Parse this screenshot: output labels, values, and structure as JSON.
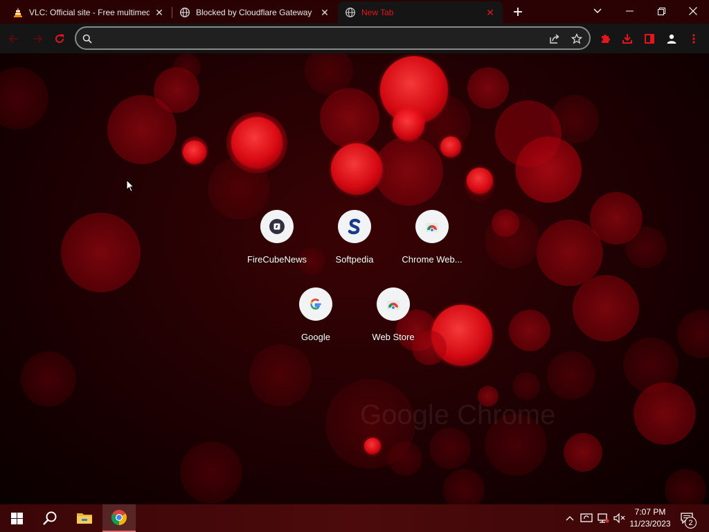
{
  "browser": {
    "tabs": [
      {
        "title": "VLC: Official site - Free multimedia",
        "icon": "vlc-cone-icon",
        "active": false
      },
      {
        "title": "Blocked by Cloudflare Gateway",
        "icon": "globe-icon",
        "active": false
      },
      {
        "title": "New Tab",
        "icon": "globe-icon",
        "active": true
      }
    ],
    "omnibox": {
      "value": "",
      "placeholder": ""
    },
    "accent_color": "#e8141b"
  },
  "shortcuts": [
    {
      "label": "FireCubeNews",
      "icon": "firecubenews-icon"
    },
    {
      "label": "Softpedia",
      "icon": "softpedia-s-icon"
    },
    {
      "label": "Chrome Web...",
      "icon": "chrome-web-store-icon"
    },
    {
      "label": "Google",
      "icon": "google-g-icon"
    },
    {
      "label": "Web Store",
      "icon": "chrome-web-store-icon"
    }
  ],
  "wallpaper": {
    "watermark": "Google Chrome"
  },
  "taskbar": {
    "time": "7:07 PM",
    "date": "11/23/2023",
    "notification_count": "2"
  }
}
